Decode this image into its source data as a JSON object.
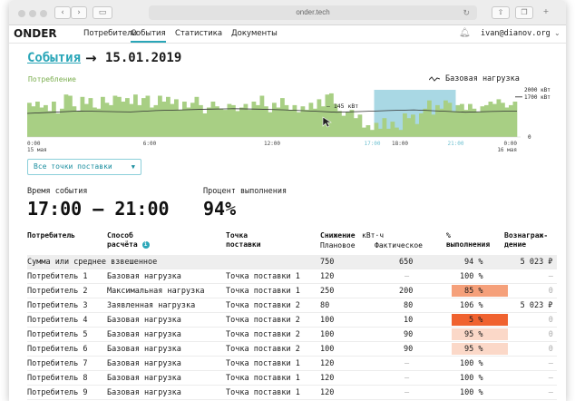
{
  "browser": {
    "url": "onder.tech"
  },
  "nav": {
    "logo": "ONDER",
    "items": [
      "Потребители",
      "События",
      "Статистика",
      "Документы"
    ],
    "active": "События",
    "user": "ivan@dianov.org"
  },
  "heading": {
    "crumb": "События",
    "arrow": "→",
    "date": "15.01.2019"
  },
  "chart": {
    "label": "Потребление",
    "legend": "Базовая нагрузка",
    "y_labels": {
      "top": "2000 кВт",
      "mark": "1700 кВт",
      "zero": "0"
    },
    "base_label": "145 кВт",
    "x_labels": [
      {
        "t": "0:00",
        "sub": "15 мая"
      },
      {
        "t": "6:00",
        "sub": ""
      },
      {
        "t": "12:00",
        "sub": ""
      },
      {
        "t": "17:00",
        "sub": "",
        "hl": true
      },
      {
        "t": "18:00",
        "sub": ""
      },
      {
        "t": "21:00",
        "sub": "",
        "hl": true
      },
      {
        "t": "0:00",
        "sub": "16 мая"
      }
    ]
  },
  "chart_data": {
    "type": "bar",
    "title": "Потребление",
    "ylim": [
      0,
      2000
    ],
    "series": [
      {
        "name": "Потребление",
        "values": [
          1450,
          1300,
          1500,
          1250,
          1350,
          1100,
          1500,
          1000,
          1200,
          1800,
          1750,
          1300,
          1100,
          1700,
          1400,
          1650,
          1250,
          1200,
          1700,
          1450,
          1350,
          1750,
          1700,
          1500,
          1650,
          1400,
          1800,
          1350,
          1650,
          1750,
          1250,
          1350,
          1750,
          1500,
          1700,
          1400,
          1600,
          1150,
          1500,
          1250,
          1450,
          1700,
          1350,
          1000,
          1250,
          1500,
          1300,
          1200,
          1150,
          1400,
          1350,
          1100,
          1250,
          1400,
          1150,
          1500,
          1350,
          1750,
          1300,
          1050,
          1450,
          1250,
          1650,
          1350,
          1150,
          1350,
          1050,
          1300,
          1150,
          1450,
          1200,
          1600,
          1300,
          1800,
          1850,
          1400,
          1100,
          900,
          1050,
          1150,
          800,
          950,
          400,
          500,
          300,
          600,
          350,
          800,
          350,
          650,
          400,
          300,
          1000,
          800,
          950,
          550,
          1000,
          1200,
          1550,
          950,
          1350,
          1200,
          1550,
          1450,
          1100,
          1350,
          1400,
          1150,
          1400,
          1200,
          1050,
          1300,
          1350,
          1500,
          1400,
          1600,
          1450,
          1250,
          1350,
          1500
        ]
      },
      {
        "name": "Базовая нагрузка",
        "values": [
          1000,
          1050,
          1100,
          1080,
          1060,
          1120,
          1150,
          1180,
          1200,
          1180,
          1150,
          1100,
          1050,
          1080,
          1120,
          1150,
          1100,
          1050,
          1080,
          1100
        ]
      }
    ],
    "highlight": {
      "from": "17:00",
      "to": "21:00"
    },
    "annotation": "145 кВт"
  },
  "filter": {
    "label": "Все точки поставки"
  },
  "stats": {
    "time_label": "Время события",
    "time_value": "17:00 — 21:00",
    "pct_label": "Процент выполнения",
    "pct_value": "94%"
  },
  "table": {
    "headers": {
      "consumer": "Потребитель",
      "method_1": "Способ",
      "method_2": "расчёта",
      "info": "i",
      "point_1": "Точка",
      "point_2": "поставки",
      "reduction": "Снижение",
      "unit": "кВт·ч",
      "planned": "Плановое",
      "actual": "Фактическое",
      "pct_1": "%",
      "pct_2": "выполнения",
      "reward_1": "Вознаграж-",
      "reward_2": "дение"
    },
    "rows": [
      {
        "consumer": "Сумма или среднее взвешенное",
        "method": "",
        "point": "",
        "planned": "750",
        "actual": "650",
        "pct": "94 %",
        "reward": "5 023 ₽",
        "color": "",
        "sum": true
      },
      {
        "consumer": "Потребитель 1",
        "method": "Базовая нагрузка",
        "point": "Точка поставки 1",
        "planned": "120",
        "actual": "—",
        "pct": "100 %",
        "reward": "—",
        "color": ""
      },
      {
        "consumer": "Потребитель 2",
        "method": "Максимальная нагрузка",
        "point": "Точка поставки 1",
        "planned": "250",
        "actual": "200",
        "pct": "85 %",
        "reward": "0",
        "color": "#f5a07a"
      },
      {
        "consumer": "Потребитель 3",
        "method": "Заявленная нагрузка",
        "point": "Точка поставки 2",
        "planned": "80",
        "actual": "80",
        "pct": "106 %",
        "reward": "5 023 ₽",
        "color": ""
      },
      {
        "consumer": "Потребитель 4",
        "method": "Базовая нагрузка",
        "point": "Точка поставки 2",
        "planned": "100",
        "actual": "10",
        "pct": "5 %",
        "reward": "0",
        "color": "#f0622f"
      },
      {
        "consumer": "Потребитель 5",
        "method": "Базовая нагрузка",
        "point": "Точка поставки 2",
        "planned": "100",
        "actual": "90",
        "pct": "95 %",
        "reward": "0",
        "color": "#fbd8c8"
      },
      {
        "consumer": "Потребитель 6",
        "method": "Базовая нагрузка",
        "point": "Точка поставки 2",
        "planned": "100",
        "actual": "90",
        "pct": "95 %",
        "reward": "0",
        "color": "#fbd8c8"
      },
      {
        "consumer": "Потребитель 7",
        "method": "Базовая нагрузка",
        "point": "Точка поставки 1",
        "planned": "120",
        "actual": "—",
        "pct": "100 %",
        "reward": "—",
        "color": ""
      },
      {
        "consumer": "Потребитель 8",
        "method": "Базовая нагрузка",
        "point": "Точка поставки 1",
        "planned": "120",
        "actual": "—",
        "pct": "100 %",
        "reward": "—",
        "color": ""
      },
      {
        "consumer": "Потребитель 9",
        "method": "Базовая нагрузка",
        "point": "Точка поставки 1",
        "planned": "120",
        "actual": "—",
        "pct": "100 %",
        "reward": "—",
        "color": ""
      }
    ]
  },
  "colors": {
    "accent": "#2aa6b8",
    "bars": "#a8cf84",
    "highlight": "#a9d8e4",
    "line": "#333333"
  }
}
